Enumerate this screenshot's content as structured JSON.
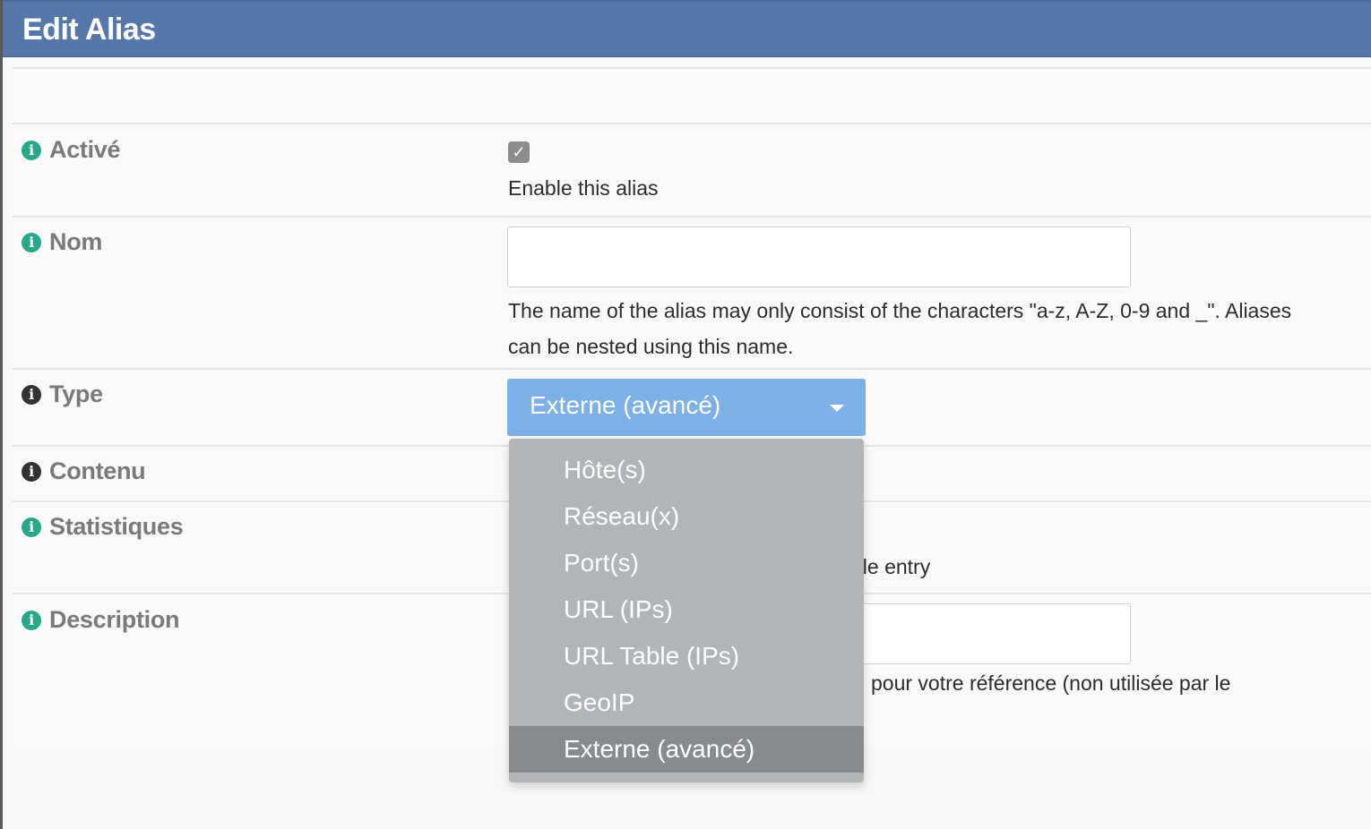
{
  "header": {
    "title": "Edit Alias"
  },
  "form": {
    "enabled": {
      "label": "Activé",
      "checked": true,
      "description": "Enable this alias"
    },
    "name": {
      "label": "Nom",
      "value": "",
      "help": "The name of the alias may only consist of the characters \"a-z, A-Z, 0-9 and _\". Aliases can be nested using this name."
    },
    "type": {
      "label": "Type",
      "selected": "Externe (avancé)",
      "options": [
        "Hôte(s)",
        "Réseau(x)",
        "Port(s)",
        "URL (IPs)",
        "URL Table (IPs)",
        "GeoIP",
        "Externe (avancé)"
      ]
    },
    "content": {
      "label": "Contenu"
    },
    "statistics": {
      "label": "Statistiques",
      "help_visible": "ble entry"
    },
    "description": {
      "label": "Description",
      "value": "",
      "help_visible": "pour votre référence (non utilisée par le"
    }
  },
  "colors": {
    "header_bg": "#5577aa",
    "select_bg": "#7db0e6",
    "menu_bg": "#b2b5b7",
    "menu_selected_bg": "#888b8e",
    "info_icon_teal": "#27a88a"
  },
  "icons": {
    "info": "info-circle-icon",
    "check": "checkmark-icon",
    "caret": "caret-down-icon"
  }
}
